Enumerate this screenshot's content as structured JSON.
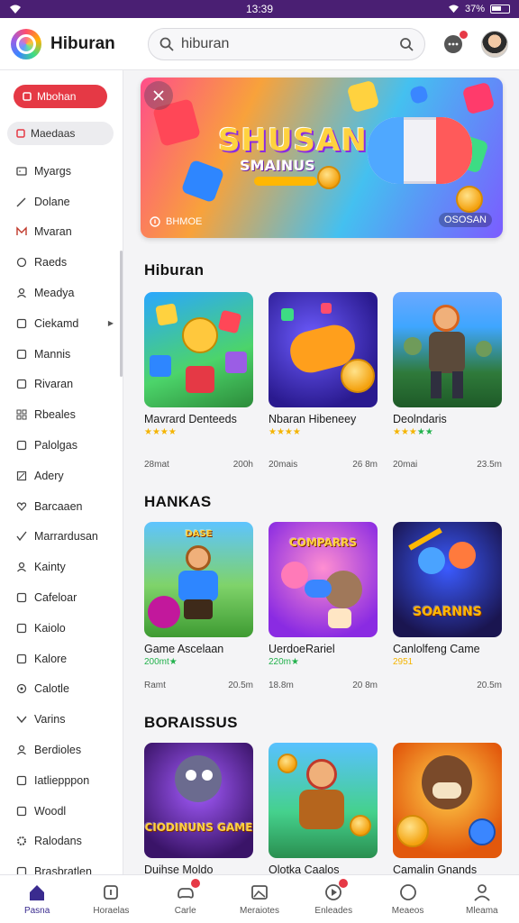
{
  "status_bar": {
    "time": "13:39",
    "battery": "37%"
  },
  "header": {
    "app_title": "Hiburan",
    "search_value": "hiburan"
  },
  "sidebar": {
    "cta_label": "Mbohan",
    "active_label": "Maedaas",
    "items": [
      {
        "label": "Myargs",
        "icon": "game-icon"
      },
      {
        "label": "Dolane",
        "icon": "pencil-icon"
      },
      {
        "label": "Mvaran",
        "icon": "m-icon"
      },
      {
        "label": "Raeds",
        "icon": "circle-icon"
      },
      {
        "label": "Meadya",
        "icon": "person-icon"
      },
      {
        "label": "Ciekamd",
        "icon": "square-icon",
        "has_submenu": true
      },
      {
        "label": "Mannis",
        "icon": "square-icon"
      },
      {
        "label": "Rivaran",
        "icon": "square-icon"
      },
      {
        "label": "Rbeales",
        "icon": "grid-icon"
      },
      {
        "label": "Palolgas",
        "icon": "square-icon"
      },
      {
        "label": "Adery",
        "icon": "chart-icon"
      },
      {
        "label": "Barcaaen",
        "icon": "heart-icon"
      },
      {
        "label": "Marrardusan",
        "icon": "check-icon"
      },
      {
        "label": "Kainty",
        "icon": "person-icon"
      },
      {
        "label": "Cafeloar",
        "icon": "square-icon"
      },
      {
        "label": "Kaiolo",
        "icon": "square-icon"
      },
      {
        "label": "Kalore",
        "icon": "square-icon"
      },
      {
        "label": "Calotle",
        "icon": "loop-icon"
      },
      {
        "label": "Varins",
        "icon": "chevron-icon"
      },
      {
        "label": "Berdioles",
        "icon": "person-icon"
      },
      {
        "label": "Iatliepppon",
        "icon": "square-icon"
      },
      {
        "label": "Woodl",
        "icon": "square-icon"
      },
      {
        "label": "Ralodans",
        "icon": "gear-icon"
      },
      {
        "label": "Brasbratlen",
        "icon": "square-icon"
      }
    ]
  },
  "banner": {
    "title": "SHUSAN",
    "subtitle": "SMAINUS",
    "footer_left": "BHMOE",
    "footer_right": "OSOSAN"
  },
  "sections": [
    {
      "title": "Hiburan",
      "cards": [
        {
          "title": "Mavrard Denteeds",
          "stars": "★★★★",
          "green": "",
          "meta_left": "28mat",
          "meta_right": "200h"
        },
        {
          "title": "Nbaran Hibeneey",
          "stars": "★★★★",
          "green": "",
          "meta_left": "20mais",
          "meta_right": "26 8m"
        },
        {
          "title": "Deolndaris",
          "stars": "★★★",
          "green": "★★",
          "meta_left": "20mai",
          "meta_right": "23.5m"
        }
      ]
    },
    {
      "title": "HANKAS",
      "cards": [
        {
          "title": "Game Ascelaan",
          "stars": "",
          "green": "200mt★",
          "meta_left": "Ramt",
          "meta_right": "20.5m"
        },
        {
          "title": "UerdoeRariel",
          "stars": "",
          "green": "220m★",
          "meta_left": "18.8m",
          "meta_right": "20 8m"
        },
        {
          "title": "Canlolfeng Came",
          "stars": "2951",
          "green": "",
          "meta_left": "",
          "meta_right": "20.5m"
        }
      ]
    },
    {
      "title": "BORAISSUS",
      "cards": [
        {
          "title": "Duihse Moldo",
          "stars": "★★★★",
          "green": "",
          "meta_left": "",
          "meta_right": ""
        },
        {
          "title": "Olotka Caalos",
          "stars": "★★★★",
          "green": "",
          "meta_left": "",
          "meta_right": ""
        },
        {
          "title": "Camalin Gnands",
          "stars": "★★★★",
          "green": "",
          "meta_left": "",
          "meta_right": ""
        }
      ]
    }
  ],
  "thumb_texts": {
    "g2_0": "DASE",
    "g2_1": "COMPARRS",
    "g2_2": "SOARNNS",
    "g3_0": "CIODINUNS GAME"
  },
  "bottom_nav": [
    {
      "label": "Pasna",
      "icon": "home-icon",
      "active": true
    },
    {
      "label": "Horaelas",
      "icon": "square-icon"
    },
    {
      "label": "Carle",
      "icon": "gamepad-icon",
      "badge": true
    },
    {
      "label": "Meraiotes",
      "icon": "image-icon"
    },
    {
      "label": "Enleades",
      "icon": "play-icon",
      "badge": true
    },
    {
      "label": "Meaeos",
      "icon": "circle-icon"
    },
    {
      "label": "Mleama",
      "icon": "person-icon"
    }
  ]
}
